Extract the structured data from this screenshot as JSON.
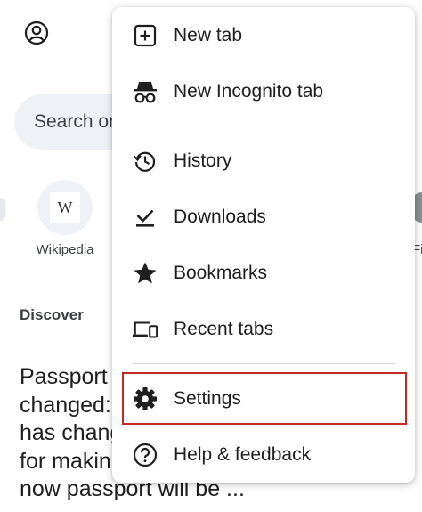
{
  "background": {
    "search": {
      "placeholder": "Search or"
    },
    "shortcuts": [
      {
        "label": "Wikipedia",
        "glyph": "W"
      },
      {
        "label": "Fi"
      }
    ],
    "discover": {
      "label": "Discover"
    },
    "article": {
      "lines": [
        "Passport",
        "changed:",
        "has chang",
        "for makin",
        "now passport will be ..."
      ]
    }
  },
  "menu": {
    "items": [
      {
        "label": "New tab",
        "icon": "new-tab-icon"
      },
      {
        "label": "New Incognito tab",
        "icon": "incognito-icon"
      },
      {
        "label": "History",
        "icon": "history-icon"
      },
      {
        "label": "Downloads",
        "icon": "downloads-icon"
      },
      {
        "label": "Bookmarks",
        "icon": "star-icon"
      },
      {
        "label": "Recent tabs",
        "icon": "devices-icon"
      },
      {
        "label": "Settings",
        "icon": "gear-icon"
      },
      {
        "label": "Help & feedback",
        "icon": "help-icon"
      }
    ]
  },
  "colors": {
    "highlight": "#c62828",
    "icon": "#3c4043",
    "search_bg": "#eef2f6"
  }
}
